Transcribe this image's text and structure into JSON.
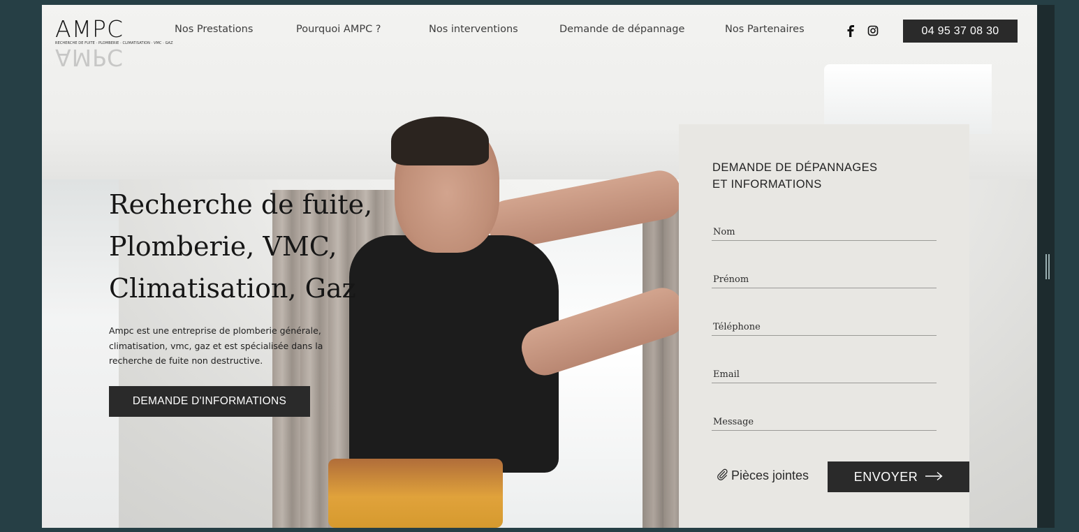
{
  "logo": {
    "name": "AMPC",
    "tagline": "RECHERCHE DE FUITE · PLOMBERIE · CLIMATISATION · VMC · GAZ"
  },
  "nav": {
    "items": [
      {
        "label": "Nos Prestations"
      },
      {
        "label": "Pourquoi AMPC ?"
      },
      {
        "label": "Nos interventions"
      },
      {
        "label": "Demande de dépannage"
      },
      {
        "label": "Nos Partenaires"
      }
    ],
    "social": [
      "facebook-icon",
      "instagram-icon"
    ],
    "phone": "04 95 37 08 30"
  },
  "hero": {
    "title_lines": [
      "Recherche de fuite,",
      "Plomberie, VMC,",
      "Climatisation, Gaz"
    ],
    "description": "Ampc est une entreprise de plomberie générale, climatisation, vmc, gaz et est spécialisée dans la recherche de fuite non destructive.",
    "cta_label": "DEMANDE D'INFORMATIONS"
  },
  "form": {
    "title_line1": "DEMANDE DE DÉPANNAGES",
    "title_line2": "ET INFORMATIONS",
    "fields": [
      {
        "placeholder": "Nom"
      },
      {
        "placeholder": "Prénom"
      },
      {
        "placeholder": "Téléphone"
      },
      {
        "placeholder": "Email"
      },
      {
        "placeholder": "Message"
      }
    ],
    "attach_label": "Pièces jointes",
    "submit_label": "ENVOYER"
  },
  "colors": {
    "page_bg": "#263f45",
    "dark_button": "#2a2a2a",
    "form_bg": "#e8e7e3"
  }
}
